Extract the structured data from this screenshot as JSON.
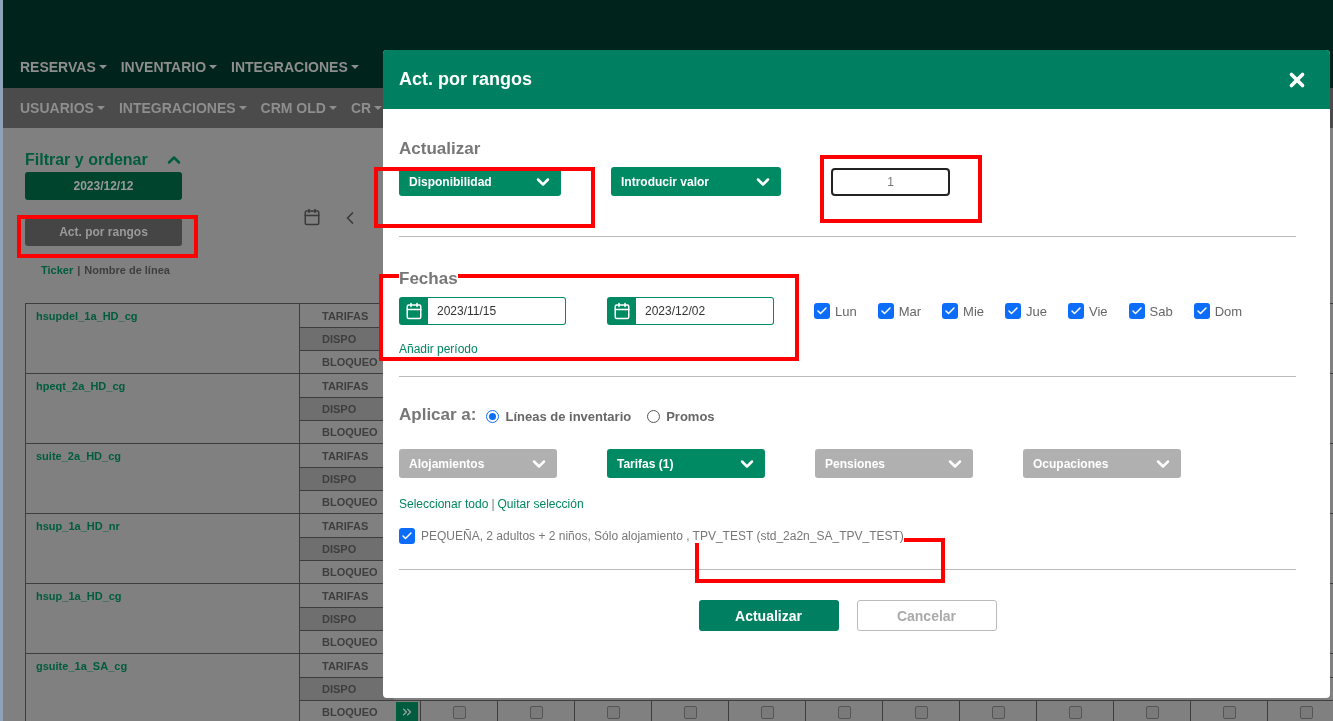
{
  "top_nav": [
    {
      "label": "RESERVAS"
    },
    {
      "label": "INVENTARIO"
    },
    {
      "label": "INTEGRACIONES"
    }
  ],
  "sub_nav": [
    {
      "label": "USUARIOS"
    },
    {
      "label": "INTEGRACIONES"
    },
    {
      "label": "CRM OLD"
    },
    {
      "label": "CR"
    }
  ],
  "sidebar": {
    "title": "Filtrar y ordenar",
    "expanded": true,
    "date_button": "2023/12/12",
    "range_button": "Act. por rangos",
    "sort_separator": "|",
    "sort_options": [
      {
        "label": "Ticker",
        "selected": true
      },
      {
        "label": "Nombre de línea",
        "selected": false
      }
    ]
  },
  "table": {
    "rows": [
      {
        "name": "hsupdel_1a_HD_cg",
        "lines": [
          "TARIFAS",
          "DISPO",
          "BLOQUEO"
        ]
      },
      {
        "name": "hpeqt_2a_HD_cg",
        "lines": [
          "TARIFAS",
          "DISPO",
          "BLOQUEO"
        ]
      },
      {
        "name": "suite_2a_HD_cg",
        "lines": [
          "TARIFAS",
          "DISPO",
          "BLOQUEO"
        ]
      },
      {
        "name": "hsup_1a_HD_nr",
        "lines": [
          "TARIFAS",
          "DISPO",
          "BLOQUEO"
        ]
      },
      {
        "name": "hsup_1a_HD_cg",
        "lines": [
          "TARIFAS",
          "DISPO",
          "BLOQUEO"
        ]
      },
      {
        "name": "gsuite_1a_SA_cg",
        "lines": [
          "TARIFAS",
          "DISPO",
          "BLOQUEO"
        ]
      }
    ],
    "day_checkboxes": [
      {
        "checked": false
      },
      {
        "checked": false
      },
      {
        "checked": false
      },
      {
        "checked": false
      },
      {
        "checked": false
      },
      {
        "checked": false
      },
      {
        "checked": false
      },
      {
        "checked": false
      },
      {
        "checked": false
      },
      {
        "checked": false
      },
      {
        "checked": false
      },
      {
        "checked": false
      }
    ]
  },
  "modal": {
    "title": "Act. por rangos",
    "update_section": {
      "label": "Actualizar",
      "selects": [
        "Disponibilidad",
        "Introducir valor"
      ],
      "value": "1"
    },
    "dates_section": {
      "label": "Fechas",
      "from": "2023/11/15",
      "to": "2023/12/02",
      "days": [
        {
          "label": "Lun",
          "checked": true
        },
        {
          "label": "Mar",
          "checked": true
        },
        {
          "label": "Mie",
          "checked": true
        },
        {
          "label": "Jue",
          "checked": true
        },
        {
          "label": "Vie",
          "checked": true
        },
        {
          "label": "Sab",
          "checked": true
        },
        {
          "label": "Dom",
          "checked": true
        }
      ],
      "add_link": "Añadir período"
    },
    "apply_section": {
      "label": "Aplicar a:",
      "targets": [
        {
          "label": "Líneas de inventario",
          "selected": true
        },
        {
          "label": "Promos",
          "selected": false
        }
      ],
      "filters": [
        {
          "label": "Alojamientos",
          "active": false
        },
        {
          "label": "Tarifas (1)",
          "active": true
        },
        {
          "label": "Pensiones",
          "active": false
        },
        {
          "label": "Ocupaciones",
          "active": false
        }
      ],
      "select_all": "Seleccionar todo",
      "separator": "|",
      "clear": "Quitar selección",
      "items": [
        {
          "label": "PEQUEÑA, 2 adultos + 2 niños, Sólo alojamiento , TPV_TEST (std_2a2n_SA_TPV_TEST)",
          "checked": true
        }
      ]
    },
    "buttons": [
      {
        "label": "Actualizar",
        "kind": "primary"
      },
      {
        "label": "Cancelar",
        "kind": "secondary"
      }
    ]
  }
}
